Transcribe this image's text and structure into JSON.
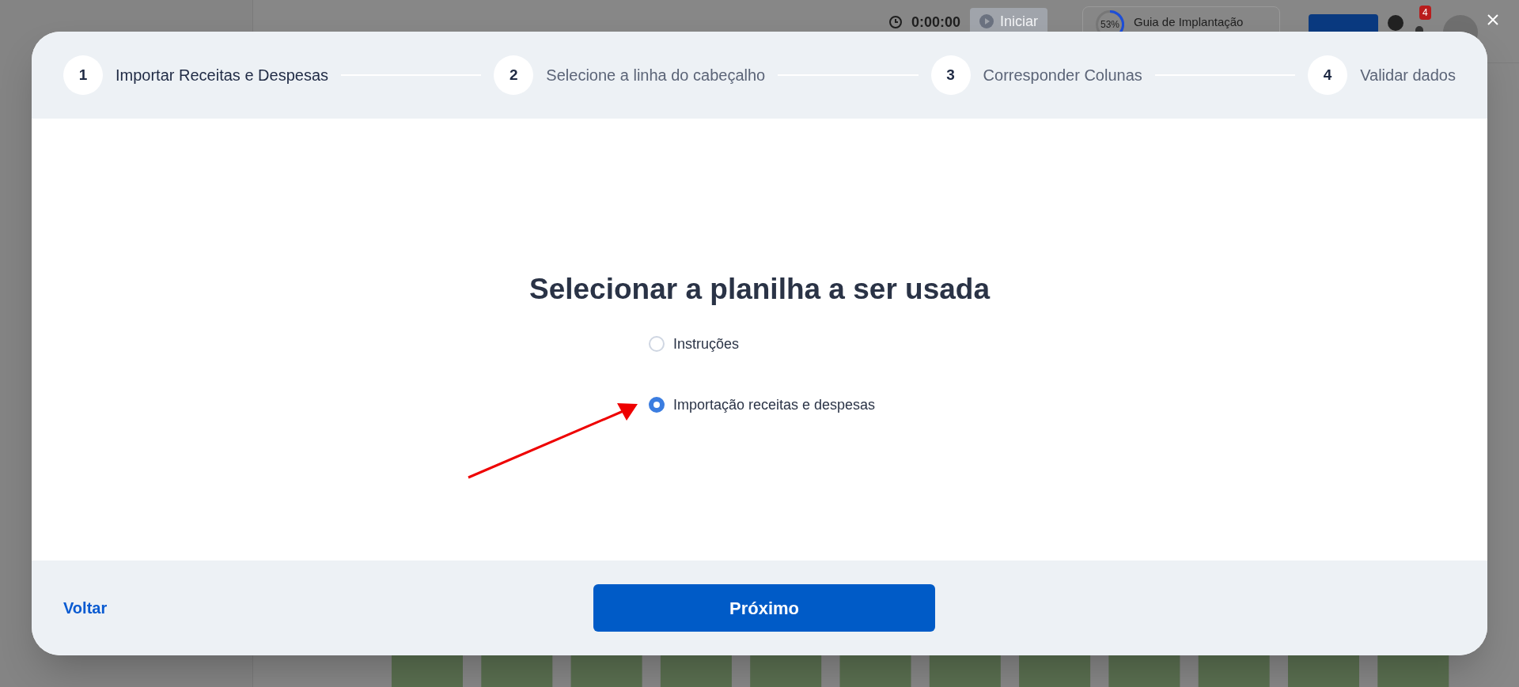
{
  "background": {
    "timer": "0:00:00",
    "start_button": "Iniciar",
    "guide": {
      "percent": "53%",
      "title": "Guia de Implantação"
    },
    "notification_count": "4"
  },
  "dialog": {
    "steps": [
      {
        "number": "1",
        "label": "Importar Receitas e Despesas",
        "selected": true
      },
      {
        "number": "2",
        "label": "Selecione a linha do cabeçalho",
        "selected": false
      },
      {
        "number": "3",
        "label": "Corresponder Colunas",
        "selected": false
      },
      {
        "number": "4",
        "label": "Validar dados",
        "selected": false
      }
    ],
    "heading": "Selecionar a planilha a ser usada",
    "options": [
      {
        "label": "Instruções",
        "selected": false
      },
      {
        "label": "Importação receitas e despesas",
        "selected": true
      }
    ],
    "back_link": "Voltar",
    "next_button": "Próximo"
  }
}
